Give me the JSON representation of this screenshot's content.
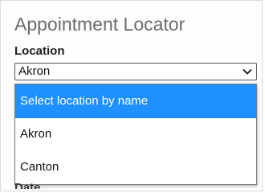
{
  "title": "Appointment Locator",
  "location": {
    "label": "Location",
    "selected_value": "Akron",
    "options": [
      "Select location by name",
      "Akron",
      "Canton"
    ],
    "highlighted_option": "Select location by name"
  },
  "date": {
    "label": "Date"
  },
  "colors": {
    "highlight": "#1e90ff",
    "title": "#6c6c6c",
    "border": "#777777"
  },
  "icons": {
    "dropdown": "chevron-down-icon"
  }
}
